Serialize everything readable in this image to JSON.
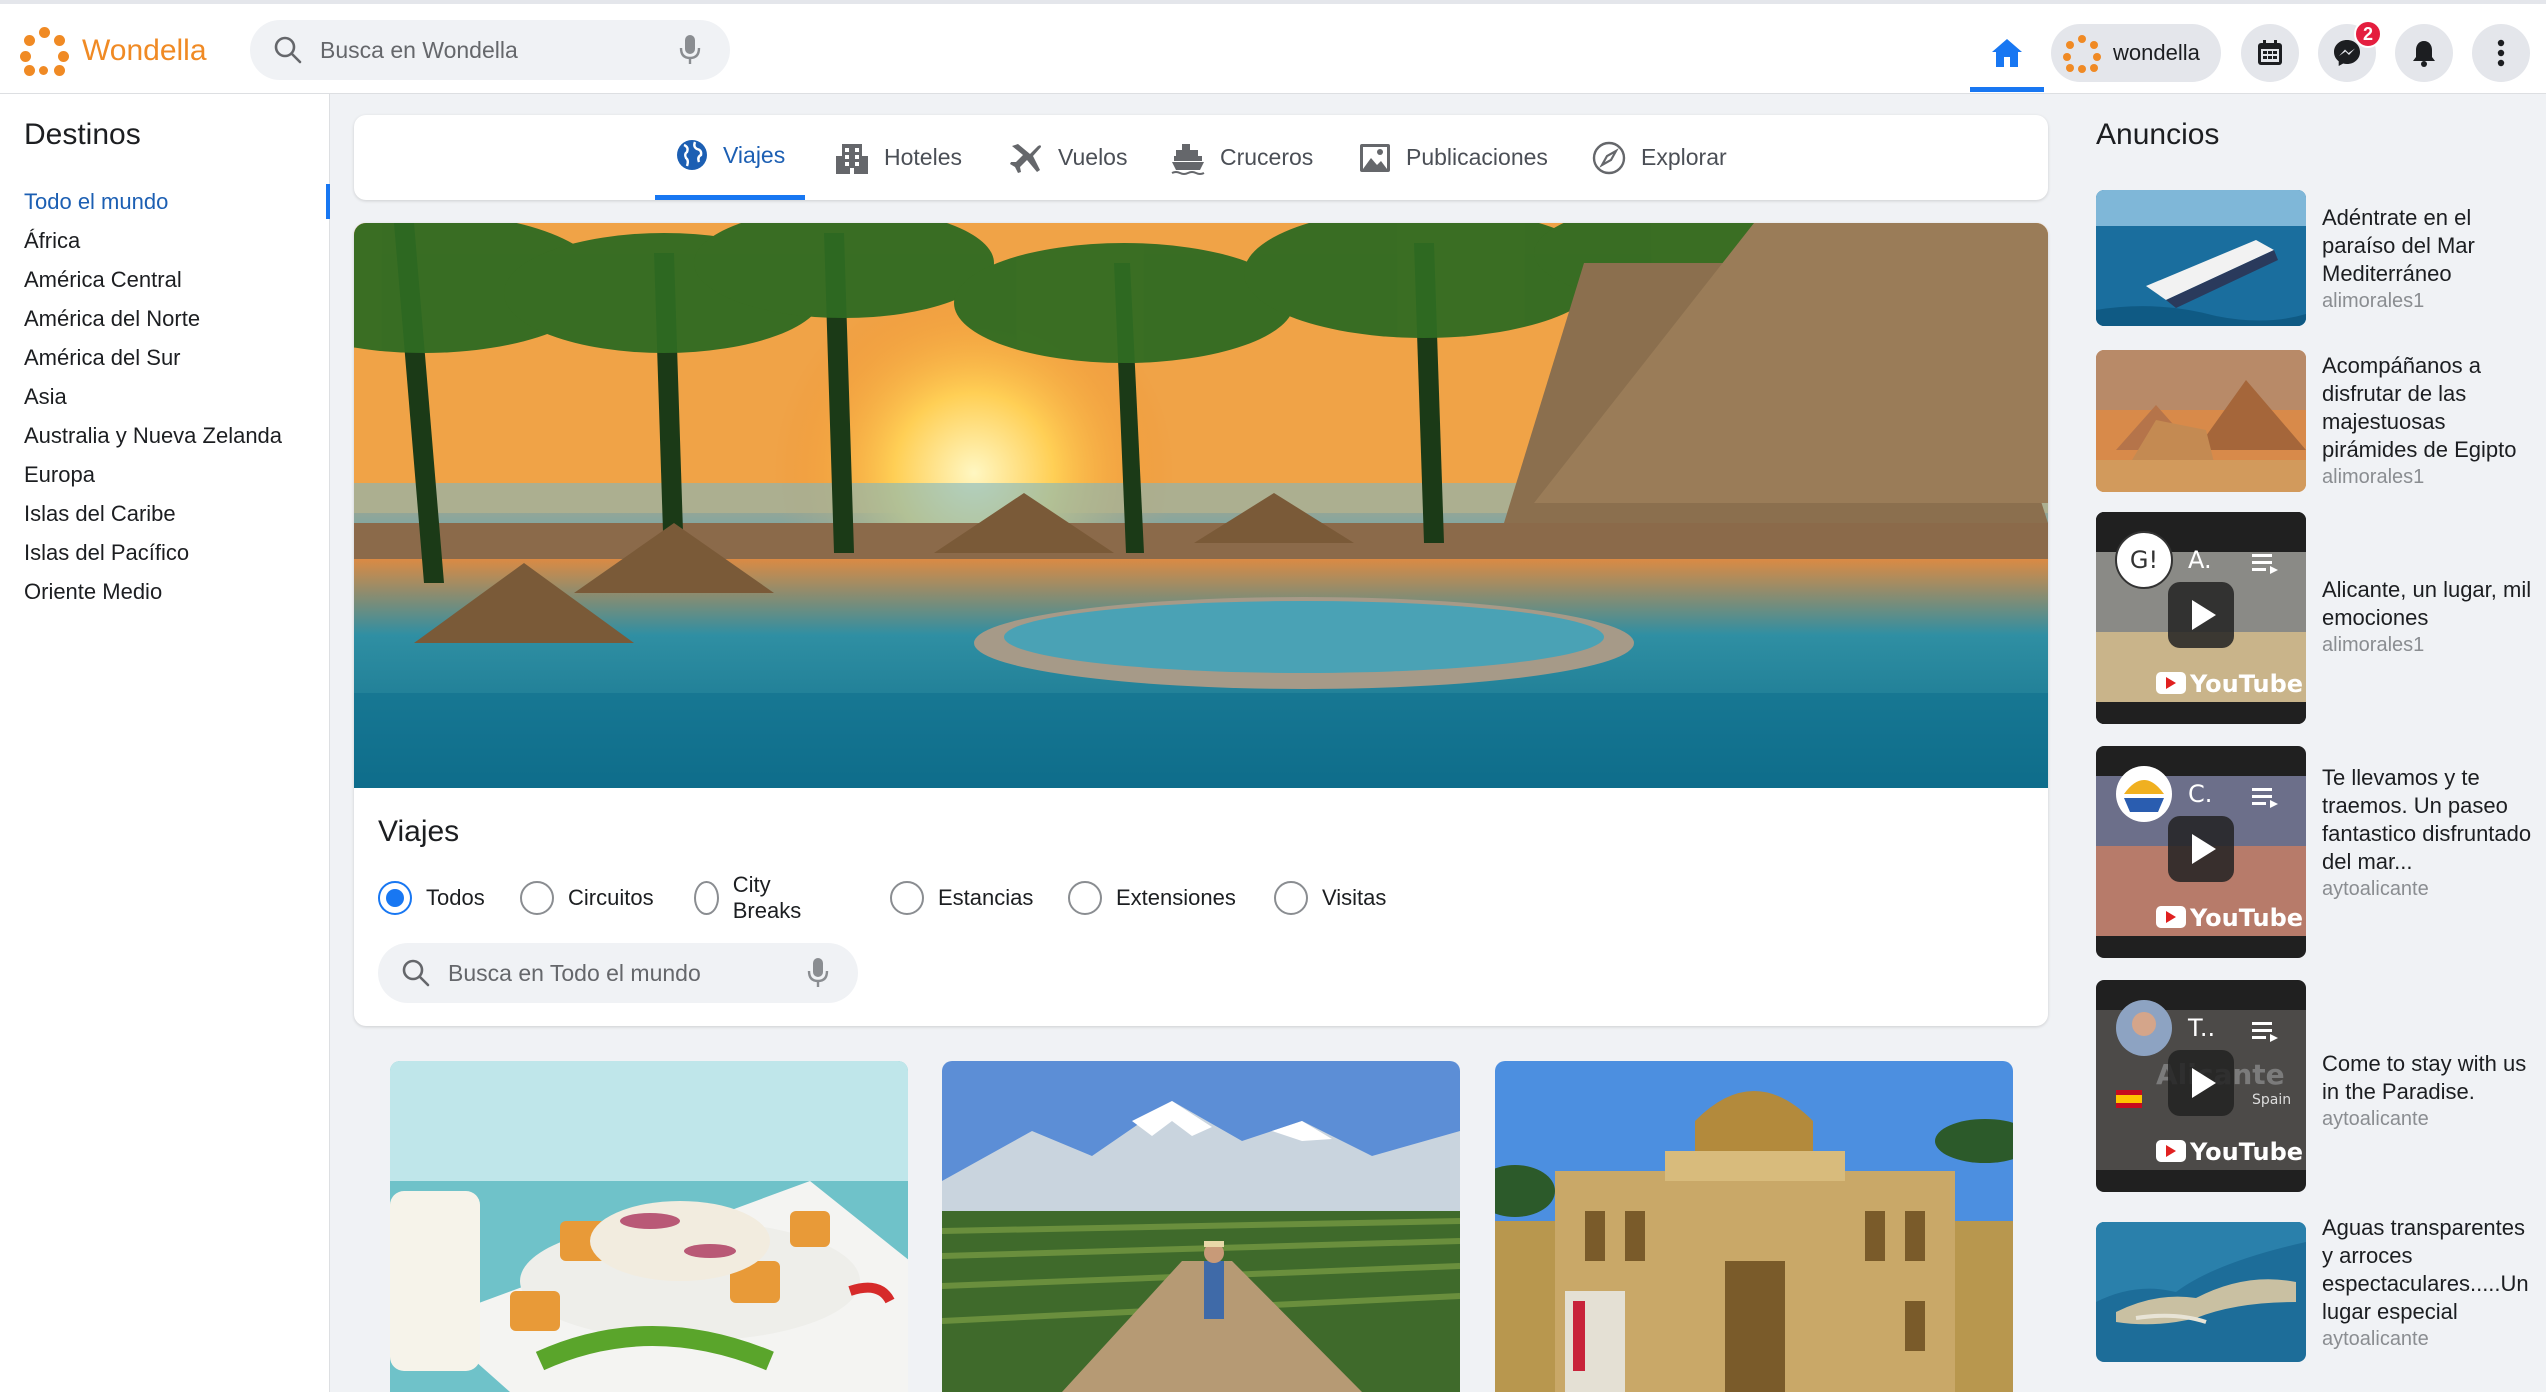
{
  "app": {
    "name": "Wondella",
    "search_placeholder": "Busca en Wondella",
    "profile_name": "wondella",
    "messenger_badge": "2"
  },
  "sidebar": {
    "title": "Destinos",
    "items": [
      {
        "label": "Todo el mundo",
        "active": true
      },
      {
        "label": "África"
      },
      {
        "label": "América Central"
      },
      {
        "label": "América del Norte"
      },
      {
        "label": "América del Sur"
      },
      {
        "label": "Asia"
      },
      {
        "label": "Australia y Nueva Zelanda"
      },
      {
        "label": "Europa"
      },
      {
        "label": "Islas del Caribe"
      },
      {
        "label": "Islas del Pacífico"
      },
      {
        "label": "Oriente Medio"
      }
    ]
  },
  "tabs": [
    {
      "label": "Viajes",
      "icon": "globe-icon",
      "active": true
    },
    {
      "label": "Hoteles",
      "icon": "hotel-icon"
    },
    {
      "label": "Vuelos",
      "icon": "plane-icon"
    },
    {
      "label": "Cruceros",
      "icon": "ship-icon"
    },
    {
      "label": "Publicaciones",
      "icon": "image-icon"
    },
    {
      "label": "Explorar",
      "icon": "compass-icon"
    }
  ],
  "main": {
    "section_title": "Viajes",
    "filters": [
      {
        "label": "Todos",
        "checked": true
      },
      {
        "label": "Circuitos"
      },
      {
        "label": "City Breaks"
      },
      {
        "label": "Estancias"
      },
      {
        "label": "Extensiones"
      },
      {
        "label": "Visitas"
      }
    ],
    "search_placeholder": "Busca en Todo el mundo"
  },
  "ads": {
    "title": "Anuncios",
    "items": [
      {
        "title": "Adéntrate en el paraíso del Mar Mediterráneo",
        "author": "alimorales1"
      },
      {
        "title": "Acompáñanos a disfrutar de las majestuosas pirámides de Egipto",
        "author": "alimorales1"
      },
      {
        "title": "Alicante, un lugar, mil emociones",
        "author": "alimorales1",
        "video_label": "A."
      },
      {
        "title": "Te llevamos y te traemos. Un paseo fantastico disfruntado del mar...",
        "author": "aytoalicante",
        "video_label": "C."
      },
      {
        "title": "Come to stay with us in the Paradise.",
        "author": "aytoalicante",
        "video_label": "T..",
        "video_overlay": "Alicante",
        "video_sub": "Spain"
      },
      {
        "title": "Aguas transparentes y arroces espectaculares.....Un lugar especial",
        "author": "aytoalicante"
      }
    ],
    "youtube_label": "YouTube"
  },
  "colors": {
    "brand": "#f08a24",
    "accent": "#1877f2",
    "active_text": "#1c5fb3"
  }
}
